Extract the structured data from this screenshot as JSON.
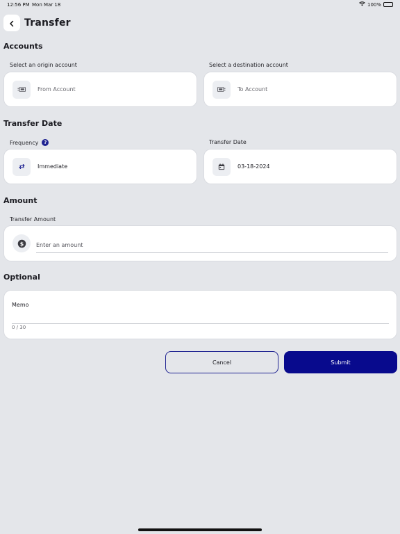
{
  "status_bar": {
    "time": "12:56 PM",
    "date": "Mon Mar 18",
    "battery": "100%"
  },
  "header": {
    "title": "Transfer"
  },
  "accounts": {
    "section_title": "Accounts",
    "origin": {
      "label": "Select an origin account",
      "placeholder": "From Account"
    },
    "destination": {
      "label": "Select a destination account",
      "placeholder": "To Account"
    }
  },
  "transfer_date": {
    "section_title": "Transfer Date",
    "frequency": {
      "label": "Frequency",
      "help": "?",
      "value": "Immediate"
    },
    "date": {
      "label": "Transfer Date",
      "value": "03-18-2024"
    }
  },
  "amount": {
    "section_title": "Amount",
    "label": "Transfer Amount",
    "placeholder": "Enter an amount"
  },
  "optional": {
    "section_title": "Optional",
    "memo_label": "Memo",
    "memo_count": "0 / 30"
  },
  "actions": {
    "cancel_label": "Cancel",
    "submit_label": "Submit"
  },
  "colors": {
    "accent": "#080a8d",
    "background": "#e4e6ea",
    "card": "#ffffff"
  },
  "icons": {
    "back": "chevron-left-icon",
    "from_account": "wallet-out-icon",
    "to_account": "wallet-in-icon",
    "frequency": "repeat-icon",
    "date": "calendar-icon",
    "amount": "dollar-icon"
  }
}
